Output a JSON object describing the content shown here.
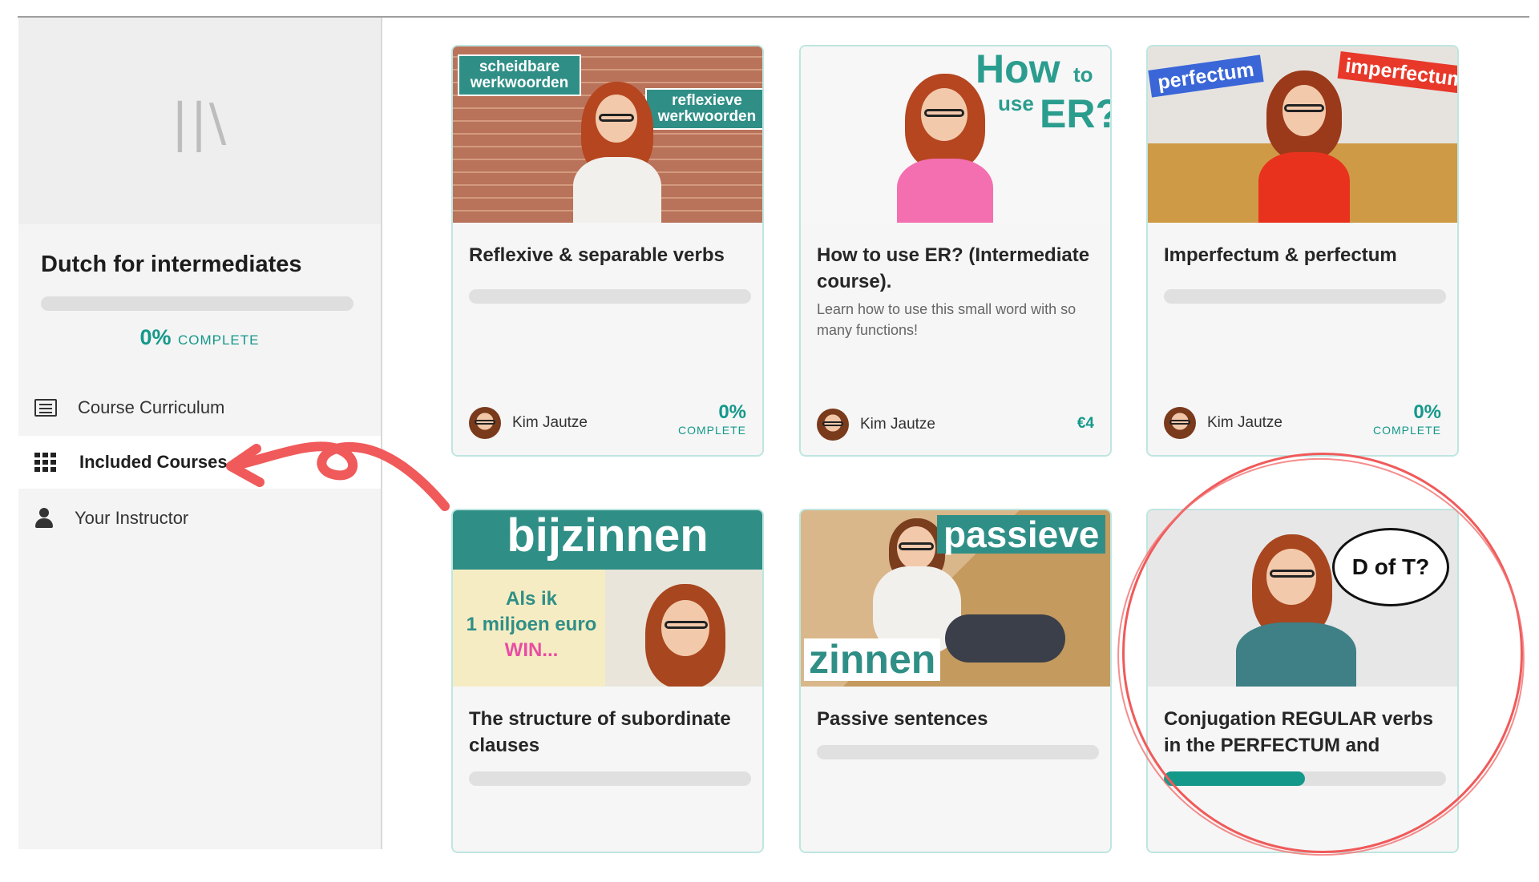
{
  "sidebar": {
    "logo_glyph": "||\\",
    "course_title": "Dutch for intermediates",
    "progress_percent": "0%",
    "progress_label": "COMPLETE",
    "progress_value": 0,
    "nav": [
      {
        "label": "Course Curriculum",
        "icon": "list-icon",
        "active": false
      },
      {
        "label": "Included Courses",
        "icon": "grid-icon",
        "active": true
      },
      {
        "label": "Your Instructor",
        "icon": "user-icon",
        "active": false
      }
    ]
  },
  "cards": [
    {
      "title": "Reflexive & separable verbs",
      "thumb_tags": [
        "scheidbare werkwoorden",
        "reflexieve werkwoorden"
      ],
      "author": "Kim Jautze",
      "status_pct": "0%",
      "status_label": "COMPLETE",
      "progress": 0
    },
    {
      "title": "How to use ER? (Intermediate course).",
      "subtitle": "Learn how to use this small word with so many functions!",
      "thumb_tags": [
        "How",
        "to",
        "use",
        "ER?"
      ],
      "author": "Kim Jautze",
      "price": "€4"
    },
    {
      "title": "Imperfectum & perfectum",
      "thumb_tags": [
        "perfectum",
        "imperfectum"
      ],
      "author": "Kim Jautze",
      "status_pct": "0%",
      "status_label": "COMPLETE",
      "progress": 0
    },
    {
      "title": "The structure of subordinate clauses",
      "thumb_tags": [
        "bijzinnen",
        "Als ik",
        "1 miljoen euro",
        "WIN..."
      ],
      "progress": 0
    },
    {
      "title": "Passive sentences",
      "thumb_tags": [
        "passieve",
        "zinnen"
      ],
      "progress": 0
    },
    {
      "title": "Conjugation REGULAR verbs in the PERFECTUM and",
      "thumb_tags": [
        "D of T?"
      ],
      "progress": 0.5
    }
  ],
  "colors": {
    "accent": "#14988a",
    "annotation": "#f05a5a",
    "card_border": "#bfe6e0"
  }
}
